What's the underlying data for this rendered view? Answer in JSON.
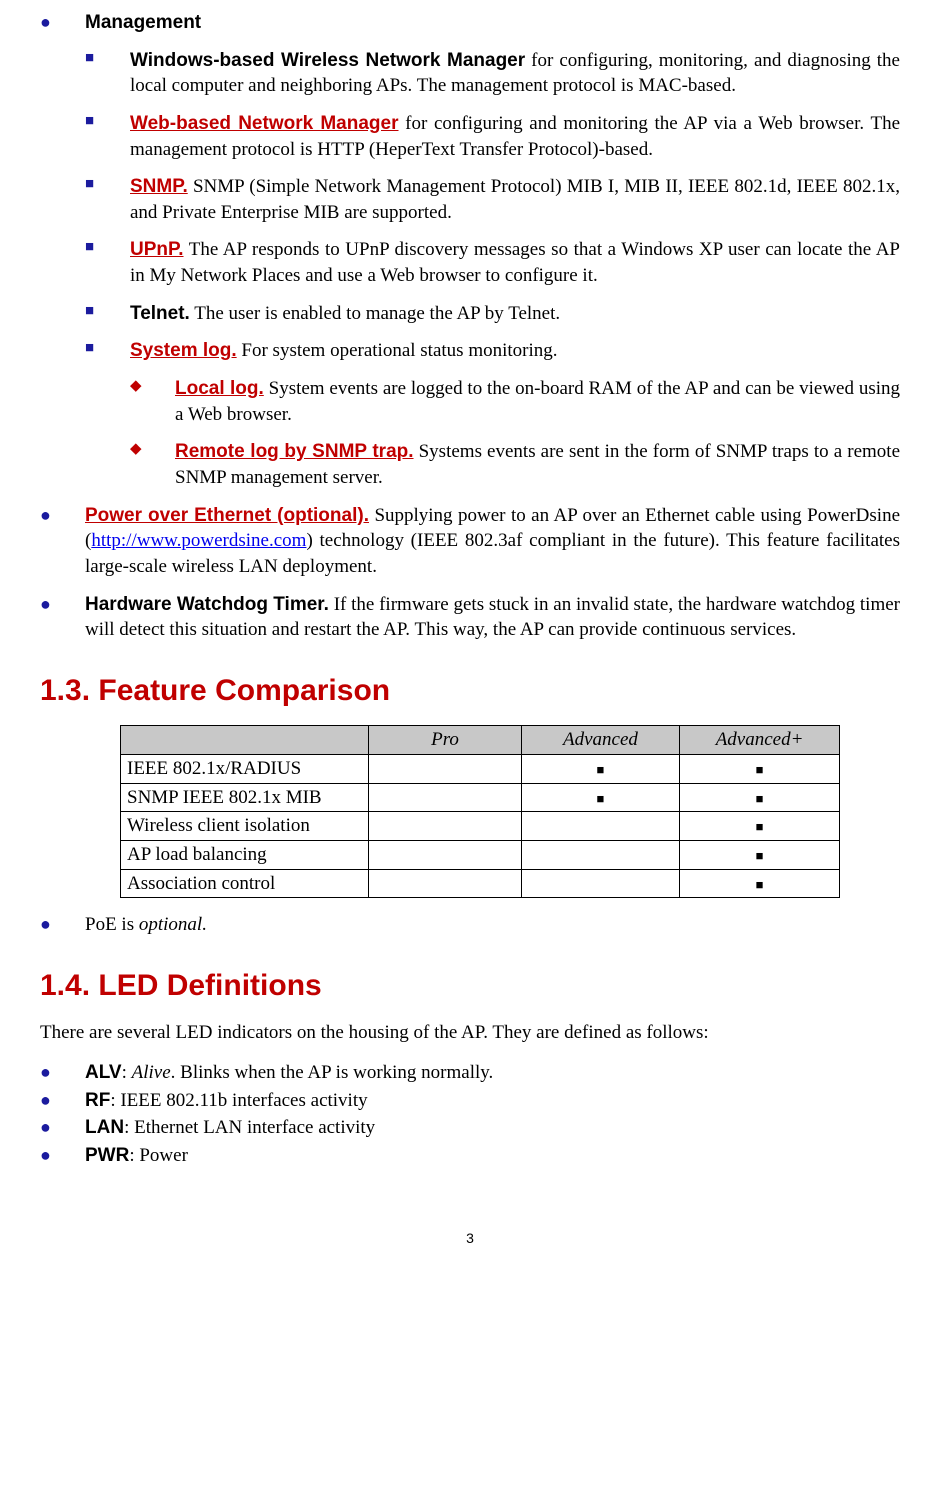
{
  "mgmt": {
    "title": "Management",
    "items": [
      {
        "lead": "Windows-based Wireless Network Manager",
        "rest": " for configuring, monitoring, and diagnosing the local computer and neighboring APs. The management protocol is MAC-based."
      },
      {
        "lead": "Web-based Network Manager",
        "link": true,
        "rest": " for configuring and monitoring the AP via a Web browser. The management protocol is HTTP (HeperText Transfer Protocol)-based."
      },
      {
        "lead": "SNMP.",
        "link": true,
        "rest": " SNMP (Simple Network Management Protocol) MIB I, MIB II, IEEE 802.1d, IEEE 802.1x, and Private Enterprise MIB are supported."
      },
      {
        "lead": "UPnP.",
        "link": true,
        "rest_a": " The AP responds to UPnP discovery messages so that a Windows XP user can locate the AP in ",
        "rest_b": "My Network Places",
        "rest_c": " and use a Web browser to configure it."
      },
      {
        "lead": "Telnet.",
        "rest": " The user is enabled to manage the AP by Telnet."
      },
      {
        "lead": "System log.",
        "link": true,
        "rest": " For system operational status monitoring."
      }
    ],
    "syslog": [
      {
        "lead": "Local log.",
        "rest": " System events are logged to the on-board RAM of the AP and can be viewed using a Web browser."
      },
      {
        "lead": "Remote log by SNMP trap.",
        "rest": " Systems events are sent in the form of SNMP traps to a remote SNMP management server."
      }
    ]
  },
  "poe": {
    "lead": "Power over Ethernet (optional).",
    "rest_a": " Supplying power to an AP over an Ethernet cable using PowerDsine (",
    "url": "http://www.powerdsine.com",
    "rest_b": ") technology (IEEE 802.3af compliant in the future). This feature facilitates large-scale wireless LAN deployment."
  },
  "hwd": {
    "lead": "Hardware Watchdog Timer.",
    "rest": " If the firmware gets stuck in an invalid state, the hardware watchdog timer will detect this situation and restart the AP.  This way, the AP can provide continuous services."
  },
  "fc": {
    "heading": "1.3. Feature Comparison",
    "cols": [
      "",
      "Pro",
      "Advanced",
      "Advanced+"
    ],
    "rows": [
      {
        "f": "IEEE 802.1x/RADIUS",
        "p": "",
        "a": "■",
        "ap": "■"
      },
      {
        "f": "SNMP IEEE 802.1x MIB",
        "p": "",
        "a": "■",
        "ap": "■"
      },
      {
        "f": "Wireless client isolation",
        "p": "",
        "a": "",
        "ap": "■"
      },
      {
        "f": "AP load balancing",
        "p": "",
        "a": "",
        "ap": "■"
      },
      {
        "f": "Association control",
        "p": "",
        "a": "",
        "ap": "■"
      }
    ],
    "note_a": "PoE is ",
    "note_b": "optional."
  },
  "led": {
    "heading": "1.4. LED Definitions",
    "intro": "There are several LED indicators on the housing of the AP. They are defined as follows:",
    "items": [
      {
        "name": "ALV",
        "sep": ": ",
        "ital": "Alive",
        "rest": ". Blinks when the AP is working normally."
      },
      {
        "name": "RF",
        "sep": ": ",
        "rest": "IEEE 802.11b interfaces activity"
      },
      {
        "name": "LAN",
        "sep": ": ",
        "rest": "Ethernet LAN interface activity"
      },
      {
        "name": "PWR",
        "sep": ": ",
        "rest": "Power"
      }
    ]
  },
  "page": "3"
}
